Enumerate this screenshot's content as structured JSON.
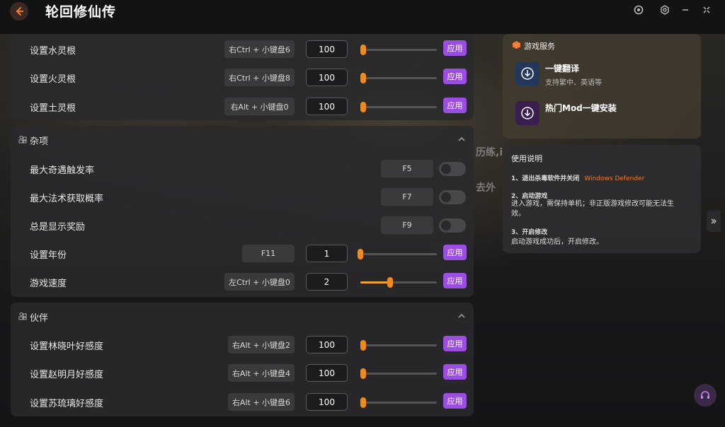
{
  "app": {
    "title": "轮回修仙传"
  },
  "colors": {
    "accent": "#9b4fe0",
    "slider": "#f28a1a",
    "brand_orange": "#f07830"
  },
  "titlebar": {
    "icons": [
      "help-icon",
      "settings-icon",
      "minimize-icon",
      "close-icon"
    ]
  },
  "talent": {
    "rows": [
      {
        "label": "设置水灵根",
        "hotkey": "右Ctrl + 小键盘6",
        "value": "100",
        "apply": "应用"
      },
      {
        "label": "设置火灵根",
        "hotkey": "右Ctrl + 小键盘8",
        "value": "100",
        "apply": "应用"
      },
      {
        "label": "设置土灵根",
        "hotkey": "右Alt + 小键盘0",
        "value": "100",
        "apply": "应用"
      }
    ]
  },
  "misc": {
    "title": "杂项",
    "rows": [
      {
        "label": "最大奇遇触发率",
        "hotkey": "F5"
      },
      {
        "label": "最大法术获取概率",
        "hotkey": "F7"
      },
      {
        "label": "总是显示奖励",
        "hotkey": "F9"
      },
      {
        "label": "设置年份",
        "hotkey": "F11",
        "value": "1",
        "apply": "应用"
      },
      {
        "label": "游戏速度",
        "hotkey": "左Ctrl + 小键盘0",
        "value": "2",
        "apply": "应用"
      }
    ]
  },
  "partner": {
    "title": "伙伴",
    "rows": [
      {
        "label": "设置林晓叶好感度",
        "hotkey": "右Alt + 小键盘2",
        "value": "100",
        "apply": "应用"
      },
      {
        "label": "设置赵明月好感度",
        "hotkey": "右Alt + 小键盘4",
        "value": "100",
        "apply": "应用"
      },
      {
        "label": "设置苏琉璃好感度",
        "hotkey": "右Alt + 小键盘6",
        "value": "100",
        "apply": "应用"
      }
    ]
  },
  "services": {
    "title": "游戏服务",
    "items": [
      {
        "title": "一键翻译",
        "subtitle": "支持繁中、英语等"
      },
      {
        "title": "热门Mod一键安装"
      }
    ]
  },
  "guide": {
    "title": "使用说明",
    "step1_prefix": "1、退出杀毒软件并关闭",
    "step1_highlight": "Windows Defender",
    "step2_title": "2、启动游戏",
    "step2_body": "进入游戏，需保持单机；非正版游戏修改可能无法生效。",
    "step3_title": "3、开启修改",
    "step3_body": "启动游戏成功后，开启修改。"
  },
  "background_text": {
    "t1": "历练,i",
    "t2": "去外"
  }
}
